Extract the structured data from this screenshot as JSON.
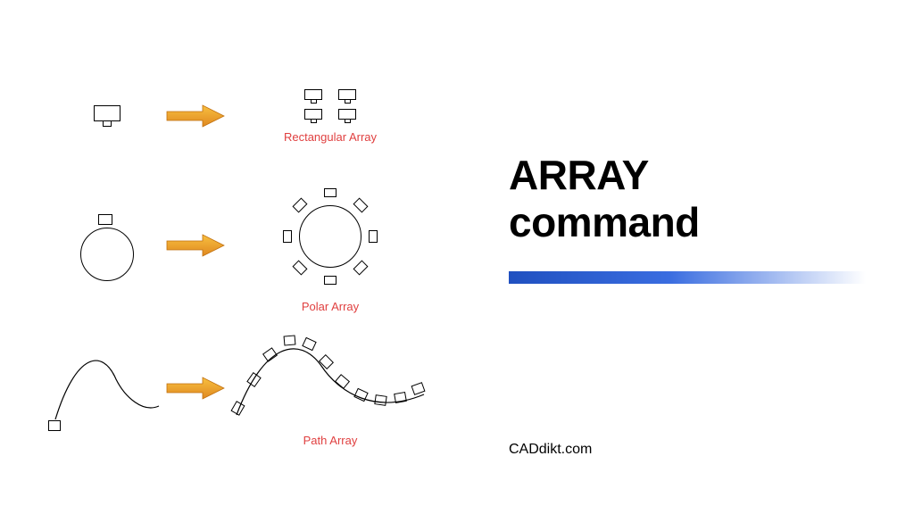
{
  "title_line1": "ARRAY",
  "title_line2": "command",
  "credit": "CADdikt.com",
  "labels": {
    "rectangular": "Rectangular Array",
    "polar": "Polar Array",
    "path": "Path Array"
  },
  "colors": {
    "label": "#e04040",
    "arrow": "#f5a623",
    "bar_start": "#2050c0"
  }
}
